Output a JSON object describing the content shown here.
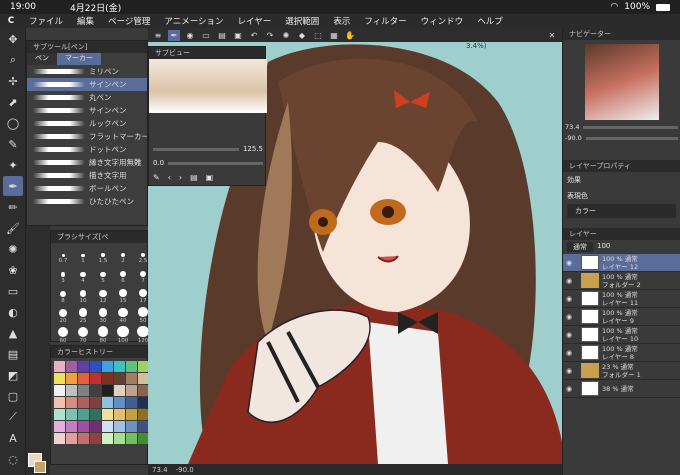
{
  "status": {
    "time": "19:00",
    "date": "4月22日(金)",
    "battery": "100%"
  },
  "menu": [
    "ファイル",
    "編集",
    "ページ管理",
    "アニメーション",
    "レイヤー",
    "選択範囲",
    "表示",
    "フィルター",
    "ウィンドウ",
    "ヘルプ"
  ],
  "subtool": {
    "title": "サブツール[ペン]",
    "tab1": "ペン",
    "tab2": "マーカー",
    "brushes": [
      "ミリペン",
      "サインペン",
      "丸ペン",
      "サインペン",
      "ルックペン",
      "フラットマーカー",
      "ドットペン",
      "縁き文字用無難",
      "描き文字用",
      "ボールペン",
      "ひたひたペン"
    ]
  },
  "navigator_title": "サブビュー",
  "navigator": {
    "zoom": "125.5",
    "angle": "0.0"
  },
  "brushsize": {
    "title": "ブラシサイズ[ペ",
    "values": [
      "0.7",
      "1",
      "1.5",
      "2",
      "2.5",
      "3",
      "4",
      "5",
      "6",
      "7",
      "8",
      "10",
      "12",
      "15",
      "17",
      "20",
      "25",
      "30",
      "40",
      "50",
      "60",
      "70",
      "80",
      "100",
      "120",
      "150",
      "170",
      "200",
      "250",
      "300",
      "400",
      "500",
      "600",
      "700",
      "800",
      "1000",
      "1200",
      "1500",
      "1700",
      "2000"
    ]
  },
  "colorhist": {
    "title": "カラーヒストリー"
  },
  "rightnav": {
    "title": "ナビゲーター",
    "zoom": "73.4",
    "angle": "-90.0"
  },
  "layerprop": {
    "title": "レイヤープロパティ",
    "effect": "効果",
    "expr": "表現色",
    "color": "カラー"
  },
  "layers": {
    "title": "レイヤー",
    "blend": "通常",
    "opacity": "100",
    "items": [
      {
        "pct": "100 % 通常",
        "name": "レイヤー 12",
        "sel": true,
        "folder": false
      },
      {
        "pct": "100 % 通常",
        "name": "フォルダー 2",
        "sel": false,
        "folder": true
      },
      {
        "pct": "100 % 通常",
        "name": "レイヤー 11",
        "sel": false,
        "folder": false
      },
      {
        "pct": "100 % 通常",
        "name": "レイヤー 9",
        "sel": false,
        "folder": false
      },
      {
        "pct": "100 % 通常",
        "name": "レイヤー 10",
        "sel": false,
        "folder": false
      },
      {
        "pct": "100 % 通常",
        "name": "レイヤー 8",
        "sel": false,
        "folder": false
      },
      {
        "pct": "23 % 通常",
        "name": "フォルダー 1",
        "sel": false,
        "folder": true
      },
      {
        "pct": "38 % 通常",
        "name": "",
        "sel": false,
        "folder": false
      }
    ]
  },
  "canvas_zoom_label": "3.4%)",
  "bottom": {
    "zoom": "73.4",
    "angle": "-90.0"
  },
  "colors": {
    "accent": "#5a6c99",
    "canvas_bg": "#9ecfcd"
  }
}
